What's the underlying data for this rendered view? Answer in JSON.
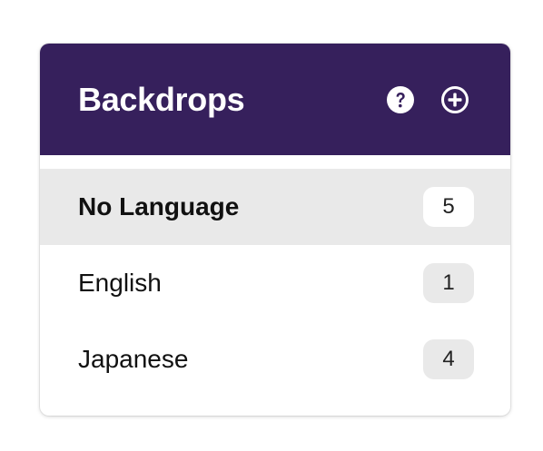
{
  "panel": {
    "title": "Backdrops",
    "header_color": "#36205c",
    "help_icon": "question-circle-icon",
    "add_icon": "plus-circle-icon"
  },
  "languages": [
    {
      "label": "No Language",
      "count": "5",
      "selected": true
    },
    {
      "label": "English",
      "count": "1",
      "selected": false
    },
    {
      "label": "Japanese",
      "count": "4",
      "selected": false
    }
  ]
}
